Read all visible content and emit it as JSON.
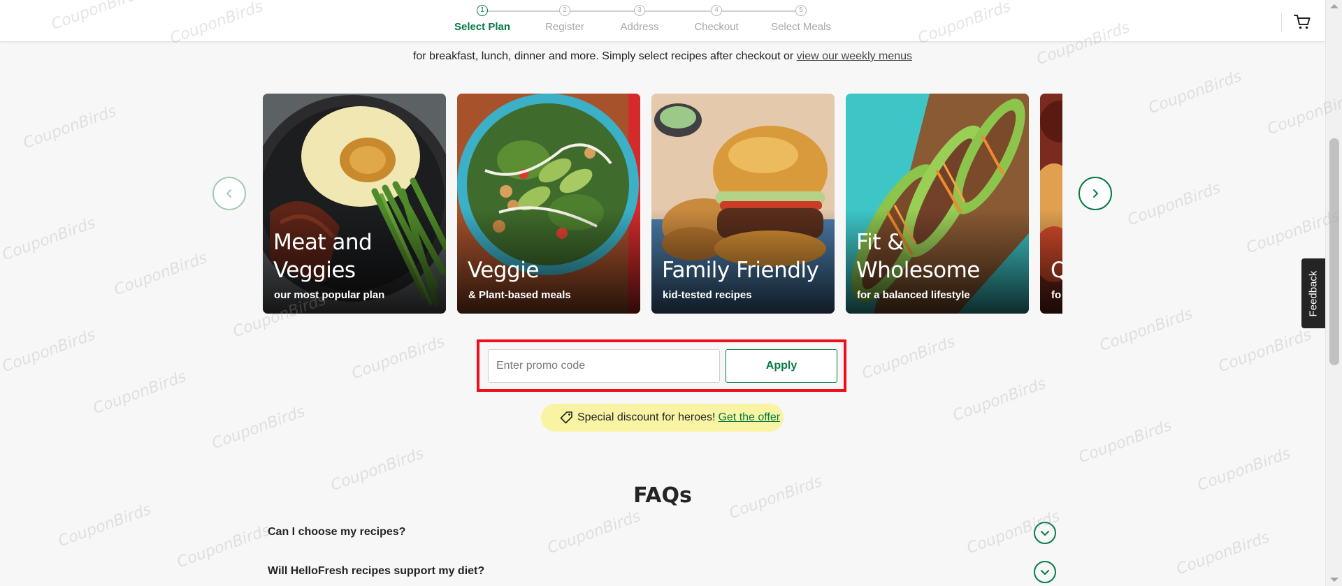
{
  "header": {
    "steps": [
      {
        "num": "1",
        "label": "Select Plan",
        "active": true
      },
      {
        "num": "2",
        "label": "Register",
        "active": false
      },
      {
        "num": "3",
        "label": "Address",
        "active": false
      },
      {
        "num": "4",
        "label": "Checkout",
        "active": false
      },
      {
        "num": "5",
        "label": "Select Meals",
        "active": false
      }
    ],
    "cart_icon": "cart-icon"
  },
  "intro": {
    "text": "for breakfast, lunch, dinner and more. Simply select recipes after checkout or ",
    "link": "view our weekly menus"
  },
  "carousel": {
    "prev_icon": "chevron-left-icon",
    "next_icon": "chevron-right-icon",
    "cards": [
      {
        "title": "Meat and Veggies",
        "subtitle": "our most popular plan"
      },
      {
        "title": "Veggie",
        "subtitle": "& Plant-based meals"
      },
      {
        "title": "Family Friendly",
        "subtitle": "kid-tested recipes"
      },
      {
        "title": "Fit & Wholesome",
        "subtitle": "for a balanced lifestyle"
      },
      {
        "title": "Q",
        "subtitle": "fo"
      }
    ]
  },
  "promo": {
    "placeholder": "Enter promo code",
    "value": "",
    "apply_label": "Apply",
    "highlight_color": "#ef0f1c"
  },
  "heroes": {
    "text": "Special discount for heroes!",
    "link": "Get the offer",
    "icon": "tag-icon"
  },
  "faq": {
    "title": "FAQs",
    "items": [
      {
        "question": "Can I choose my recipes?"
      },
      {
        "question": "Will HelloFresh recipes support my diet?"
      }
    ]
  },
  "feedback": {
    "label": "Feedback"
  },
  "watermark": {
    "text": "CouponBirds"
  },
  "colors": {
    "brand_green": "#067a46",
    "offer_yellow": "#f8f4a4"
  }
}
